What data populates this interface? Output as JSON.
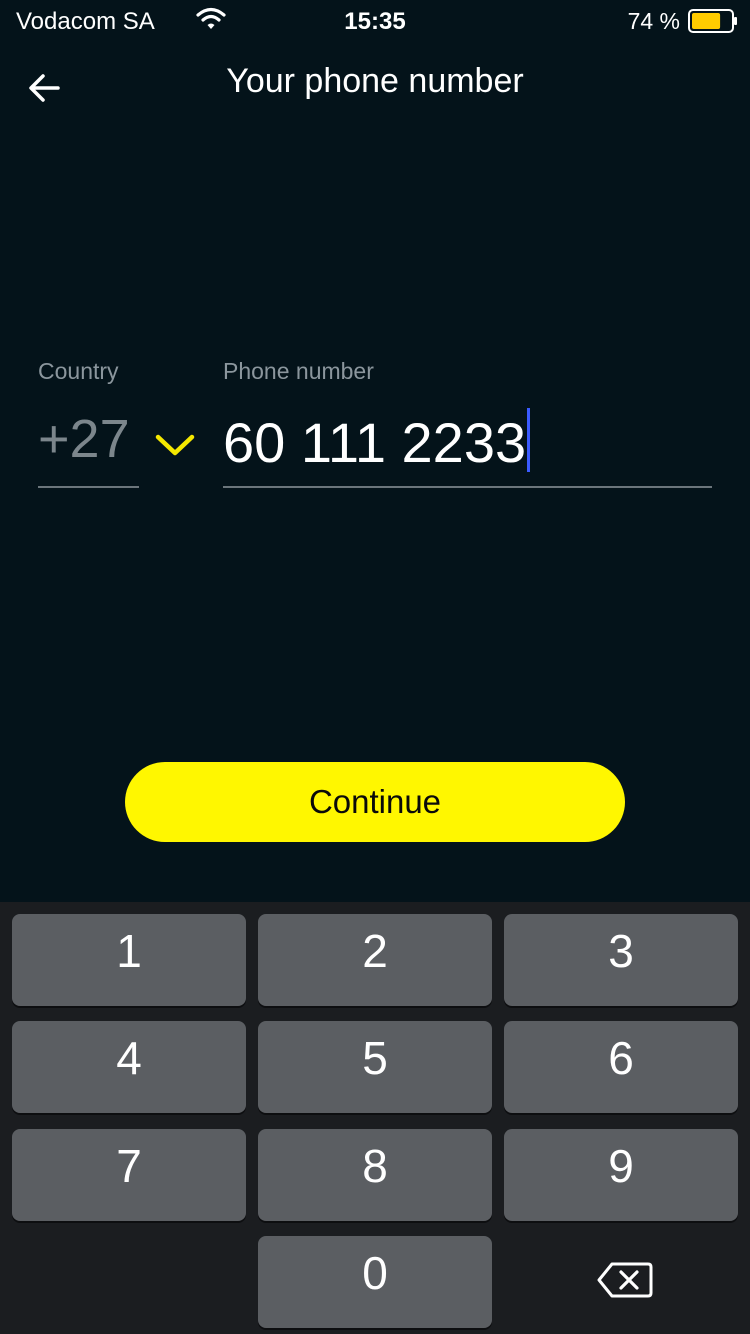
{
  "status_bar": {
    "carrier": "Vodacom SA",
    "time": "15:35",
    "battery_percent": "74 %",
    "battery_level": 0.74,
    "battery_color": "#ffcc00"
  },
  "header": {
    "back_icon": "arrow-left-icon",
    "title": "Your phone number"
  },
  "form": {
    "country_label": "Country",
    "country_code": "+27",
    "country_dropdown_icon": "chevron-down-icon",
    "phone_label": "Phone number",
    "phone_value": "60 111 2233"
  },
  "continue_button": {
    "label": "Continue",
    "color": "#fff700"
  },
  "keypad": {
    "keys": [
      "1",
      "2",
      "3",
      "4",
      "5",
      "6",
      "7",
      "8",
      "9",
      "0"
    ],
    "backspace_icon": "backspace-icon"
  }
}
